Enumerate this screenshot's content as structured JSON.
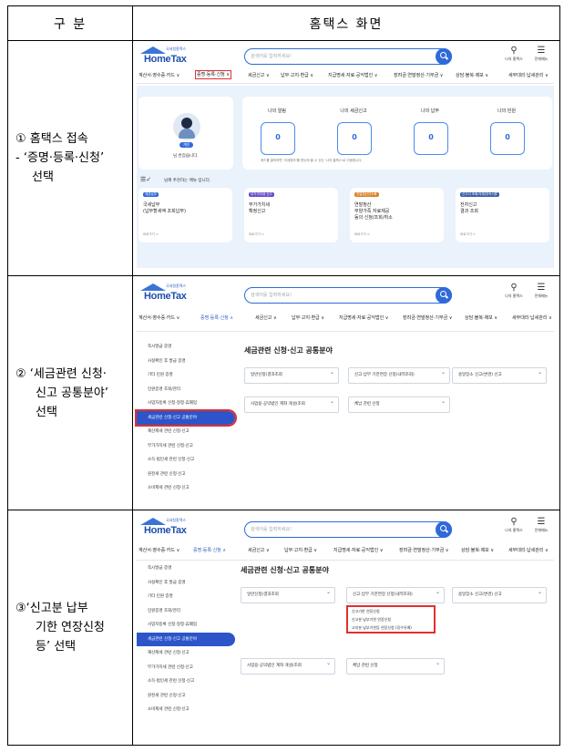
{
  "header": {
    "col1": "구 분",
    "col2": "홈택스 화면"
  },
  "steps": [
    {
      "lines": [
        "① 홈택스 접속",
        "- ‘증명·등록·신청’",
        "선택"
      ]
    },
    {
      "lines": [
        "② ‘세금관련 신청·",
        "신고 공통분야’",
        "선택"
      ]
    },
    {
      "lines": [
        "③‘신고분  납부",
        "기한  연장신청",
        "등’ 선택"
      ]
    }
  ],
  "hometax": {
    "logo_sub": "국세청홈택스",
    "logo_name": "HomeTax",
    "search_placeholder": "검색어를 입력하세요!",
    "my_hometax": "나의 홈택스",
    "all_menu": "전체메뉴",
    "nav": [
      "계산서·영수증·카드 ∨",
      "증명·등록·신청 ∨",
      "세금신고 ∨",
      "납부·고지·환급 ∨",
      "지급명세·자료·공익법인 ∨",
      "장려금·연말정산·기부금 ∨",
      "상담·불복·제보 ∨",
      "세무대리·납세관리 ∨"
    ],
    "nav_open": "증명·등록·신청 ∧"
  },
  "screen1": {
    "badge": "개인",
    "greeting": "님 반갑습니다.",
    "stats": [
      {
        "label": "나의 알림",
        "value": "0"
      },
      {
        "label": "나의 세금신고",
        "value": "0"
      },
      {
        "label": "나의 납부",
        "value": "0"
      },
      {
        "label": "나의 민원",
        "value": "0"
      }
    ],
    "hint": "위드를 클릭하면 '국세정보'를 한눈에 볼 수 있는 '나의 홈택스'로 이동합니다.",
    "recommend": "님께 추천하는 메뉴 입니다.",
    "services": [
      {
        "tag": "세금납부",
        "title": [
          "국세납부",
          "(납부할세액 조회납부)"
        ],
        "more": "바로가기 >",
        "color": "#2f6ad9"
      },
      {
        "tag": "부가가치세 신고",
        "title": [
          "부가가치세",
          "확정신고"
        ],
        "more": "바로가기 >",
        "color": "#6a4fc8"
      },
      {
        "tag": "연말정산간소화",
        "title": [
          "연말정산",
          "부양가족 자료제공",
          "동의 신청/조회/취소"
        ],
        "more": "바로가기 >",
        "color": "#d9822b"
      },
      {
        "tag": "신고서 조회/삭제/부속서류",
        "title": [
          "전자신고",
          "결과 조회"
        ],
        "more": "바로가기 >",
        "color": "#3b5fa8"
      }
    ]
  },
  "sidebar": [
    "즉시발급 증명",
    "사실확인 후 발급 증명",
    "기타 민원 증명",
    "민원증명 조회/관리",
    "사업자등록 신청·정정·휴폐업",
    "세금관련 신청·신고 공통분야",
    "재산제세 관련 신청·신고",
    "부가가치세 관련 신청·신고",
    "소득·법인세 관련 신청·신고",
    "원천세 관련 신청·신고",
    "소비제세 관련 신청·신고"
  ],
  "panel": {
    "title": "세금관련 신청·신고 공통분야",
    "items": [
      "일반신청(결과조회",
      "신고·납부 기한연장 신청(내역조회)",
      "송달장소 신고(변경) 신고",
      "사업용·공익법인 계좌 개설(조회",
      "체납 관련 신청"
    ],
    "submenu": [
      "신고기한 연장신청",
      "신고분 납부기한 연장신청",
      "고지분 납부기한등 연장신청 (징수유예)"
    ]
  }
}
